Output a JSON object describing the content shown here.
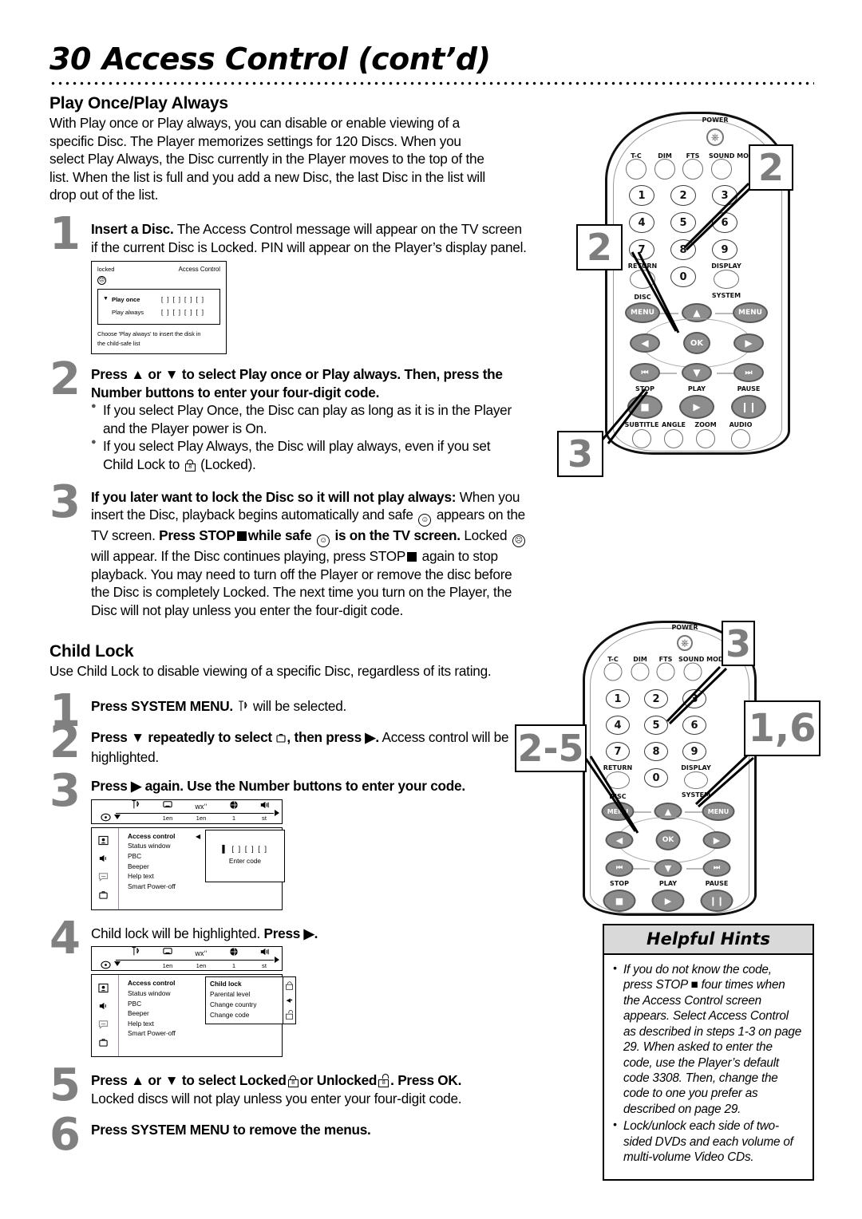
{
  "header": {
    "page_number": "30",
    "title": "Access Control (cont’d)"
  },
  "sections": {
    "play": {
      "heading": "Play Once/Play Always",
      "intro": "With Play once or Play always, you can disable or enable viewing of a specific Disc. The Player memorizes settings for 120 Discs. When you select Play Always, the Disc currently in the Player moves to the top of the list. When the list is full and you add a new Disc, the last Disc in the list will drop out of the list.",
      "steps": [
        {
          "num": "1",
          "bold_lead": "Insert a Disc.",
          "text": " The Access Control message will appear on the TV screen if the current Disc is Locked. PIN will appear on the Player’s display panel."
        },
        {
          "num": "2",
          "bold_lead": "Press ▲ or ▼ to select Play once or Play always. Then, press the Number buttons to enter your four-digit code.",
          "bullets": [
            "If you select Play Once, the Disc can play as long as it is in the Player and the Player power is On.",
            "If you select Play Always, the Disc will play always, even if you set Child Lock to  (Locked)."
          ],
          "bullet2_pre": "If you select Play Always, the Disc will play always, even if you set Child Lock to",
          "bullet2_post": "(Locked)."
        },
        {
          "num": "3",
          "bold_lead": "If you later want to lock the Disc so it will not play always:",
          "t1": "When you insert the Disc, playback begins automatically and safe",
          "t2": "appears on the TV screen.",
          "b1": "Press STOP",
          "b2": "while safe",
          "b3": "is on the TV screen.",
          "t3": "Locked",
          "t4": "will appear. If the Disc continues playing, press STOP",
          "t5": "again to stop playback. You may need to turn off the Player or remove the disc before the Disc is completely Locked. The next time you turn on the Player, the Disc will not play unless you enter the four-digit code."
        }
      ]
    },
    "child_lock": {
      "heading": "Child Lock",
      "intro": "Use Child Lock to disable viewing of a specific Disc, regardless of its rating.",
      "steps": [
        {
          "num": "1",
          "bold_lead": "Press SYSTEM MENU.",
          "text": "will be selected."
        },
        {
          "num": "2",
          "bold_lead_a": "Press ▼ repeatedly to select",
          "bold_lead_b": ", then press ▶.",
          "text": " Access control will be highlighted."
        },
        {
          "num": "3",
          "bold_lead": "Press ▶ again. Use the Number buttons to enter your code."
        },
        {
          "num": "4",
          "text_a": "Child lock will be highlighted.",
          "bold_b": "Press ▶."
        },
        {
          "num": "5",
          "bold_lead_a": "Press ▲ or ▼ to select Locked",
          "bold_lead_b": "or Unlocked",
          "bold_lead_c": ". Press OK.",
          "text": "Locked discs will not play unless you enter your four-digit code."
        },
        {
          "num": "6",
          "bold_lead": "Press SYSTEM MENU to remove the menus."
        }
      ]
    }
  },
  "tv_screen_1": {
    "status_label": "locked",
    "title": "Access Control",
    "rows": [
      {
        "caret": "▼",
        "label": "Play once",
        "boxes": "[ ] [ ] [ ] [ ]",
        "bold": true
      },
      {
        "caret": "",
        "label": "Play always",
        "boxes": "[ ] [ ] [ ] [ ]",
        "bold": false
      }
    ],
    "footer_line1": "Choose 'Play always' to insert the disk in",
    "footer_line2": "the child-safe list"
  },
  "osd_menu": {
    "bar_values": [
      "",
      "",
      "1en",
      "1en",
      "1",
      "st"
    ],
    "bar_icons": [
      "disc-icon",
      "tools-icon",
      "screen-icon",
      "subtitle-icon",
      "globe-icon",
      "audio-icon"
    ],
    "rail_icons": [
      "picture-icon",
      "sound-icon",
      "language-icon",
      "features-icon"
    ],
    "list": [
      "Access control",
      "Status window",
      "PBC",
      "Beeper",
      "Help text",
      "Smart Power-off"
    ],
    "highlighted": "Access control",
    "code_panel": {
      "boxes": "[ ] [ ] [ ]",
      "cursor": "▌",
      "prompt": "Enter code"
    },
    "submenu": {
      "items": [
        "Child lock",
        "Parental level",
        "Change country",
        "Change code"
      ],
      "highlighted": "Child lock"
    }
  },
  "remote_top": {
    "labels": {
      "power": "POWER",
      "tc": "T-C",
      "dim": "DIM",
      "fts": "FTS",
      "sound_mode": "SOUND MODE",
      "return": "RETURN",
      "display": "DISPLAY",
      "disc": "DISC",
      "system": "SYSTEM",
      "menu": "MENU",
      "ok": "OK",
      "stop": "STOP",
      "play": "PLAY",
      "pause": "PAUSE",
      "subtitle": "SUBTITLE",
      "angle": "ANGLE",
      "zoom": "ZOOM",
      "audio": "AUDIO"
    },
    "numbers": [
      "1",
      "2",
      "3",
      "4",
      "5",
      "6",
      "7",
      "8",
      "9",
      "0"
    ],
    "callouts": [
      {
        "label": "2",
        "target": "number-buttons"
      },
      {
        "label": "2",
        "target": "navigation-up-down"
      },
      {
        "label": "3",
        "target": "stop-button"
      }
    ]
  },
  "remote_bottom": {
    "labels": {
      "power": "POWER",
      "tc": "T-C",
      "dim": "DIM",
      "fts": "FTS",
      "sound_mode": "SOUND MODE",
      "return": "RETURN",
      "display": "DISPLAY",
      "disc": "DISC",
      "system": "SYSTEM",
      "menu": "MENU",
      "ok": "OK",
      "stop": "STOP",
      "play": "PLAY",
      "pause": "PAUSE"
    },
    "numbers": [
      "1",
      "2",
      "3",
      "4",
      "5",
      "6",
      "7",
      "8",
      "9",
      "0"
    ],
    "callouts": [
      {
        "label": "3",
        "target": "number-buttons"
      },
      {
        "label": "2-5",
        "target": "navigation-ok"
      },
      {
        "label": "1,6",
        "target": "system-menu-button"
      }
    ]
  },
  "hints": {
    "title": "Helpful Hints",
    "items": [
      "If you do not know the code, press STOP ■ four times when the Access Control screen appears. Select Access Control as described in steps 1-3 on page 29. When asked to enter the code, use the Player’s default code 3308. Then, change the code to one you prefer as described on page 29.",
      "Lock/unlock each side of two-sided DVDs and each volume of multi-volume Video CDs."
    ]
  }
}
